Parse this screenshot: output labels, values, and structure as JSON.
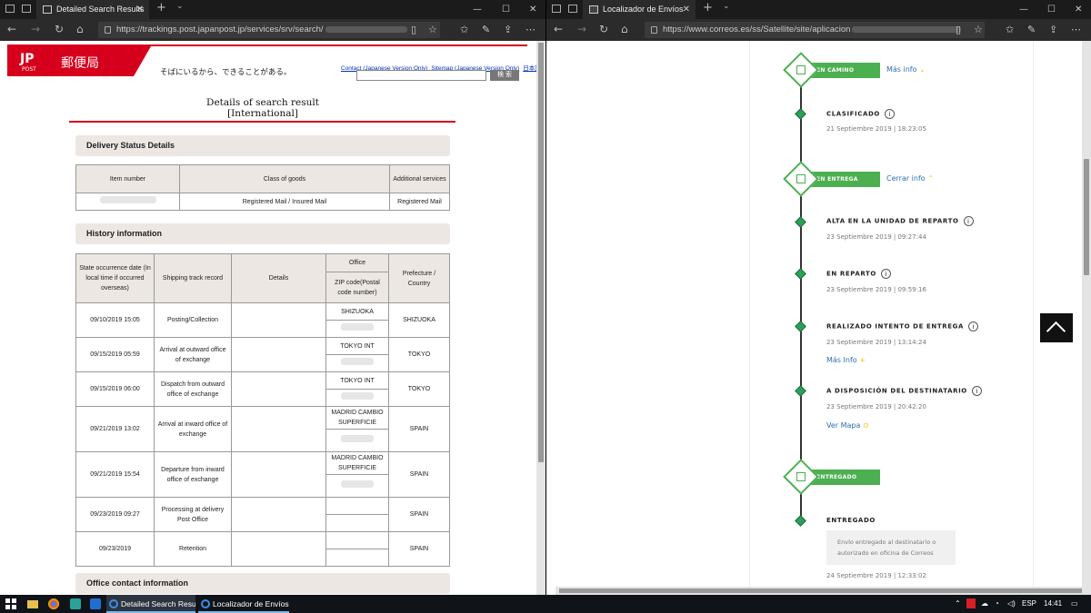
{
  "left_window": {
    "tab_title": "Detailed Search Results",
    "url": "https://trackings.post.japanpost.jp/services/srv/search/",
    "page": {
      "logo_text": "JP",
      "logo_sub": "POST",
      "brand": "郵便局",
      "tagline": "そばにいるから、できることがある。",
      "links": [
        "Contact (Japanese Version Only)",
        "Sitemap (Japanese Version Only)",
        "日本語"
      ],
      "search_button": "検 索",
      "title_line1": "Details of search result",
      "title_line2": "[International]",
      "section_delivery": "Delivery Status Details",
      "section_history": "History information",
      "section_office": "Office contact information",
      "status_table": {
        "headers": [
          "Item number",
          "Class of goods",
          "Additional services"
        ],
        "row": {
          "class": "Registered Mail / Insured Mail",
          "additional": "Registered Mail"
        }
      },
      "history_table": {
        "headers": {
          "date": "State occurrence date (In local time if occurred overseas)",
          "track": "Shipping track record",
          "details": "Details",
          "office": "Office",
          "zip": "ZIP code(Postal code number)",
          "prefecture": "Prefecture / Country"
        },
        "rows": [
          {
            "date": "09/10/2019 15:05",
            "track": "Posting/Collection",
            "office": "SHIZUOKA",
            "pref": "SHIZUOKA"
          },
          {
            "date": "09/15/2019 05:59",
            "track": "Arrival at outward office of exchange",
            "office": "TOKYO INT",
            "pref": "TOKYO"
          },
          {
            "date": "09/15/2019 06:00",
            "track": "Dispatch from outward office of exchange",
            "office": "TOKYO INT",
            "pref": "TOKYO"
          },
          {
            "date": "09/21/2019 13:02",
            "track": "Arrival at inward office of exchange",
            "office": "MADRID CAMBIO SUPERFICIE",
            "pref": "SPAIN"
          },
          {
            "date": "09/21/2019 15:54",
            "track": "Departure from inward office of exchange",
            "office": "MADRID CAMBIO SUPERFICIE",
            "pref": "SPAIN"
          },
          {
            "date": "09/23/2019 09:27",
            "track": "Processing at delivery Post Office",
            "office": "",
            "pref": "SPAIN"
          },
          {
            "date": "09/23/2019",
            "track": "Retention",
            "office": "",
            "pref": "SPAIN"
          }
        ]
      }
    }
  },
  "right_window": {
    "tab_title": "Localizador de Envíos",
    "url": "https://www.correos.es/ss/Satellite/site/aplicacion",
    "url_host": "www.correos.es",
    "timeline": {
      "stage1": {
        "label": "EN CAMINO",
        "link": "Más info",
        "link_icon": "chevron-down"
      },
      "stage2": {
        "label": "EN ENTREGA",
        "link": "Cerrar info",
        "link_icon": "chevron-up"
      },
      "stage3": {
        "label": "ENTREGADO"
      },
      "events": [
        {
          "title": "CLASIFICADO",
          "date": "21 Septiembre 2019 | 18:23:05"
        },
        {
          "title": "ALTA EN LA UNIDAD DE REPARTO",
          "date": "23 Septiembre 2019 | 09:27:44"
        },
        {
          "title": "EN REPARTO",
          "date": "23 Septiembre 2019 | 09:59:16"
        },
        {
          "title": "REALIZADO INTENTO DE ENTREGA",
          "date": "23 Septiembre 2019 | 13:14:24",
          "link": "Más Info"
        },
        {
          "title": "A DISPOSICIÓN DEL DESTINATARIO",
          "date": "23 Septiembre 2019 | 20:42:20",
          "link": "Ver Mapa"
        },
        {
          "title": "ENTREGADO",
          "message": "Envío entregado al destinatario o autorizado en oficina de Correos",
          "date": "24 Septiembre 2019 | 12:33:02"
        }
      ],
      "info_glyph": "i"
    }
  },
  "taskbar": {
    "items": [
      "Detailed Search Resul...",
      "Localizador de Envíos..."
    ],
    "lang": "ESP",
    "time": "14:41"
  },
  "colors": {
    "jp_red": "#d6001c",
    "correos_green": "#4caf50",
    "link_blue": "#2a6fb6"
  }
}
